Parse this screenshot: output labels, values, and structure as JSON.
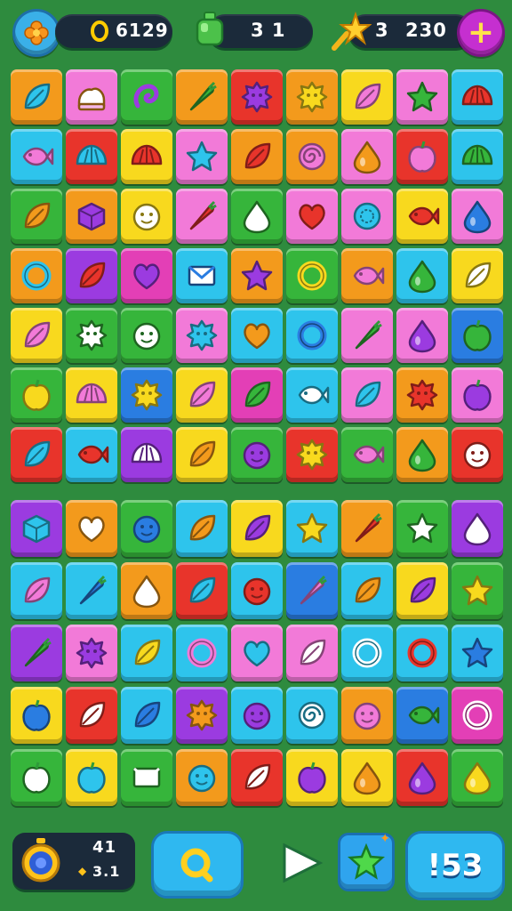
{
  "hud": {
    "coins_value": "6129",
    "moves_value": "3 1",
    "stars_count": "3",
    "stars_score": "230",
    "add_label": "+"
  },
  "bottom": {
    "timer_top": "41",
    "timer_bottom": "3.1",
    "level_value": "!53"
  },
  "colors": {
    "red": "#e8342b",
    "orange": "#f39a1c",
    "yellow": "#f8d91e",
    "green": "#36b53b",
    "cyan": "#2ec4ec",
    "blue": "#2a7de1",
    "purple": "#9b3be0",
    "pink": "#f27ad8",
    "magenta": "#e33fb6"
  },
  "board_top": [
    [
      [
        "orange",
        "leaf"
      ],
      [
        "pink",
        "cream"
      ],
      [
        "green",
        "swirl"
      ],
      [
        "orange",
        "carrot"
      ],
      [
        "red",
        "blob"
      ],
      [
        "orange",
        "blob"
      ],
      [
        "yellow",
        "leaf"
      ],
      [
        "pink",
        "star"
      ],
      [
        "cyan",
        "shell"
      ]
    ],
    [
      [
        "cyan",
        "fish"
      ],
      [
        "red",
        "shell"
      ],
      [
        "yellow",
        "shell"
      ],
      [
        "pink",
        "star"
      ],
      [
        "orange",
        "leaf"
      ],
      [
        "orange",
        "spiral"
      ],
      [
        "pink",
        "drop"
      ],
      [
        "red",
        "fruit"
      ],
      [
        "cyan",
        "shell"
      ]
    ],
    [
      [
        "green",
        "leaf"
      ],
      [
        "orange",
        "cube"
      ],
      [
        "yellow",
        "face"
      ],
      [
        "pink",
        "carrot"
      ],
      [
        "green",
        "drop"
      ],
      [
        "pink",
        "heart"
      ],
      [
        "pink",
        "disc"
      ],
      [
        "yellow",
        "fish"
      ],
      [
        "pink",
        "drop"
      ]
    ],
    [
      [
        "orange",
        "ring"
      ],
      [
        "purple",
        "leaf"
      ],
      [
        "magenta",
        "heart"
      ],
      [
        "cyan",
        "envelope"
      ],
      [
        "orange",
        "star"
      ],
      [
        "green",
        "ring"
      ],
      [
        "orange",
        "fish"
      ],
      [
        "cyan",
        "drop"
      ],
      [
        "yellow",
        "leaf"
      ]
    ],
    [
      [
        "yellow",
        "leaf"
      ],
      [
        "green",
        "blob"
      ],
      [
        "green",
        "face"
      ],
      [
        "pink",
        "blob"
      ],
      [
        "cyan",
        "heart"
      ],
      [
        "cyan",
        "ring"
      ],
      [
        "pink",
        "carrot"
      ],
      [
        "pink",
        "drop"
      ],
      [
        "blue",
        "fruit"
      ]
    ],
    [
      [
        "green",
        "fruit"
      ],
      [
        "yellow",
        "shell"
      ],
      [
        "blue",
        "blob"
      ],
      [
        "yellow",
        "leaf"
      ],
      [
        "magenta",
        "leaf"
      ],
      [
        "cyan",
        "fish"
      ],
      [
        "pink",
        "leaf"
      ],
      [
        "orange",
        "blob"
      ],
      [
        "pink",
        "fruit"
      ]
    ],
    [
      [
        "red",
        "leaf"
      ],
      [
        "cyan",
        "fish"
      ],
      [
        "purple",
        "shell"
      ],
      [
        "yellow",
        "leaf"
      ],
      [
        "green",
        "face"
      ],
      [
        "red",
        "blob"
      ],
      [
        "green",
        "fish"
      ],
      [
        "orange",
        "drop"
      ],
      [
        "red",
        "face"
      ]
    ]
  ],
  "board_bottom": [
    [
      [
        "purple",
        "cube"
      ],
      [
        "orange",
        "heart"
      ],
      [
        "green",
        "face"
      ],
      [
        "cyan",
        "leaf"
      ],
      [
        "yellow",
        "leaf"
      ],
      [
        "cyan",
        "star"
      ],
      [
        "orange",
        "carrot"
      ],
      [
        "green",
        "star"
      ],
      [
        "purple",
        "drop"
      ]
    ],
    [
      [
        "cyan",
        "leaf"
      ],
      [
        "cyan",
        "carrot"
      ],
      [
        "orange",
        "drop"
      ],
      [
        "red",
        "leaf"
      ],
      [
        "cyan",
        "face"
      ],
      [
        "blue",
        "carrot"
      ],
      [
        "cyan",
        "leaf"
      ],
      [
        "yellow",
        "leaf"
      ],
      [
        "green",
        "star"
      ]
    ],
    [
      [
        "purple",
        "carrot"
      ],
      [
        "pink",
        "blob"
      ],
      [
        "cyan",
        "leaf"
      ],
      [
        "cyan",
        "ring"
      ],
      [
        "pink",
        "heart"
      ],
      [
        "pink",
        "leaf"
      ],
      [
        "cyan",
        "ring"
      ],
      [
        "cyan",
        "ring"
      ],
      [
        "cyan",
        "star"
      ]
    ],
    [
      [
        "yellow",
        "fruit"
      ],
      [
        "red",
        "leaf"
      ],
      [
        "cyan",
        "leaf"
      ],
      [
        "purple",
        "blob"
      ],
      [
        "cyan",
        "face"
      ],
      [
        "cyan",
        "spiral"
      ],
      [
        "orange",
        "face"
      ],
      [
        "blue",
        "fish"
      ],
      [
        "magenta",
        "ring"
      ]
    ],
    [
      [
        "green",
        "fruit"
      ],
      [
        "yellow",
        "fruit"
      ],
      [
        "green",
        "envelope"
      ],
      [
        "orange",
        "face"
      ],
      [
        "red",
        "leaf"
      ],
      [
        "yellow",
        "fruit"
      ],
      [
        "yellow",
        "drop"
      ],
      [
        "red",
        "drop"
      ],
      [
        "green",
        "drop"
      ]
    ]
  ]
}
